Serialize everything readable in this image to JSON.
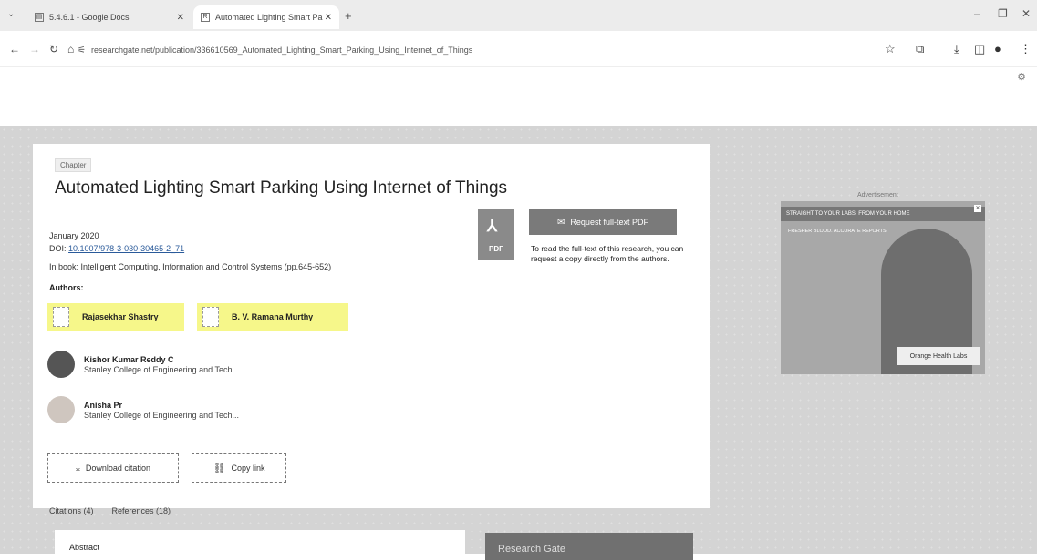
{
  "browser": {
    "tab1_title": "5.4.6.1 - Google Docs",
    "tab2_title": "Automated Lighting Smart Pa",
    "tab_close": "✕",
    "new_tab": "+",
    "url": "researchgate.net/publication/336610569_Automated_Lighting_Smart_Parking_Using_Internet_of_Things"
  },
  "publication": {
    "type_chip": "Chapter",
    "title": "Automated Lighting Smart Parking Using Internet of Things",
    "date": "January 2020",
    "doi_prefix": "DOI:",
    "doi_value": "10.1007/978-3-030-30465-2_71",
    "book_line": "In book: Intelligent Computing, Information and Control Systems (pp.645-652)",
    "authors_label": "Authors:",
    "authors": [
      {
        "name": "Rajasekhar Shastry",
        "affiliation": ""
      },
      {
        "name": "B. V. Ramana Murthy",
        "affiliation": ""
      },
      {
        "name": "Kishor Kumar Reddy C",
        "affiliation": "Stanley College of Engineering and Tech..."
      },
      {
        "name": "Anisha Pr",
        "affiliation": "Stanley College of Engineering and Tech..."
      }
    ],
    "download_citation": "Download citation",
    "copy_link": "Copy link",
    "citations_tab": "Citations (4)",
    "references_tab": "References (18)",
    "abstract_label": "Abstract",
    "panel_title": "Research Gate"
  },
  "fulltext": {
    "request_button": "Request full-text PDF",
    "pdf_label": "PDF",
    "note": "To read the full-text of this research, you can request a copy directly from the authors."
  },
  "ad": {
    "label": "Advertisement",
    "headline": "STRAIGHT TO YOUR LABS. FROM YOUR HOME",
    "sub": "FRESHER BLOOD. ACCURATE REPORTS.",
    "brand": "Orange Health Labs"
  }
}
